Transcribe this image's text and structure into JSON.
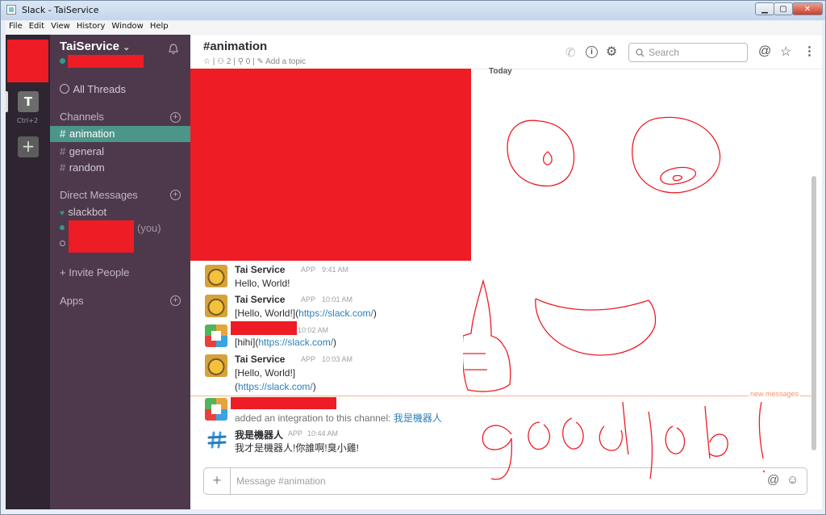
{
  "window": {
    "title": "Slack - TaiService",
    "buttons": {
      "minimize": "▁",
      "maximize": "▢",
      "close": "✕"
    }
  },
  "menu": [
    "File",
    "Edit",
    "View",
    "History",
    "Window",
    "Help"
  ],
  "teams": {
    "initial": "T",
    "shortcut": "Ctrl+2",
    "add": "+"
  },
  "sidebar": {
    "team_name": "TaiService",
    "team_caret": "⌄",
    "all_threads": "All Threads",
    "channels_header": "Channels",
    "channels": [
      {
        "label": "animation",
        "active": true
      },
      {
        "label": "general",
        "active": false
      },
      {
        "label": "random",
        "active": false
      }
    ],
    "dm_header": "Direct Messages",
    "dms": [
      {
        "label": "slackbot"
      },
      {
        "label": "(you)"
      }
    ],
    "invite": "+ Invite People",
    "apps": "Apps",
    "hash": "#"
  },
  "header": {
    "channel": "#animation",
    "members": "2",
    "pins": "0",
    "add_topic": "Add a topic",
    "search_placeholder": "Search"
  },
  "divider": {
    "today": "Today",
    "new_messages": "new messages"
  },
  "messages": [
    {
      "name": "Tai Service",
      "app": "APP",
      "time": "9:41 AM",
      "text": "Hello, World!"
    },
    {
      "name": "Tai Service",
      "app": "APP",
      "time": "10:01 AM",
      "text_pre": "[Hello, World!](",
      "link": "https://slack.com/",
      "text_post": ")"
    },
    {
      "time": "10:02 AM",
      "text_pre": "[hihi](",
      "link": "https://slack.com/",
      "text_post": ")"
    },
    {
      "name": "Tai Service",
      "app": "APP",
      "time": "10:03 AM",
      "text_pre": "[Hello, World!]",
      "text_line2_pre": "(",
      "link": "https://slack.com/",
      "text_post": ")"
    },
    {
      "text_pre": "added an integration to this channel: ",
      "link": "我是機器人"
    },
    {
      "name": "我是機器人",
      "app": "APP",
      "time": "10:44 AM",
      "text": "我才是機器人!你誰啊!臭小雞!"
    }
  ],
  "composer": {
    "placeholder": "Message #animation",
    "plus": "+"
  },
  "colors": {
    "sidebar": "#4d394b",
    "active_channel": "#4c9689",
    "link": "#2a80b9",
    "redaction": "#ee1c24"
  }
}
